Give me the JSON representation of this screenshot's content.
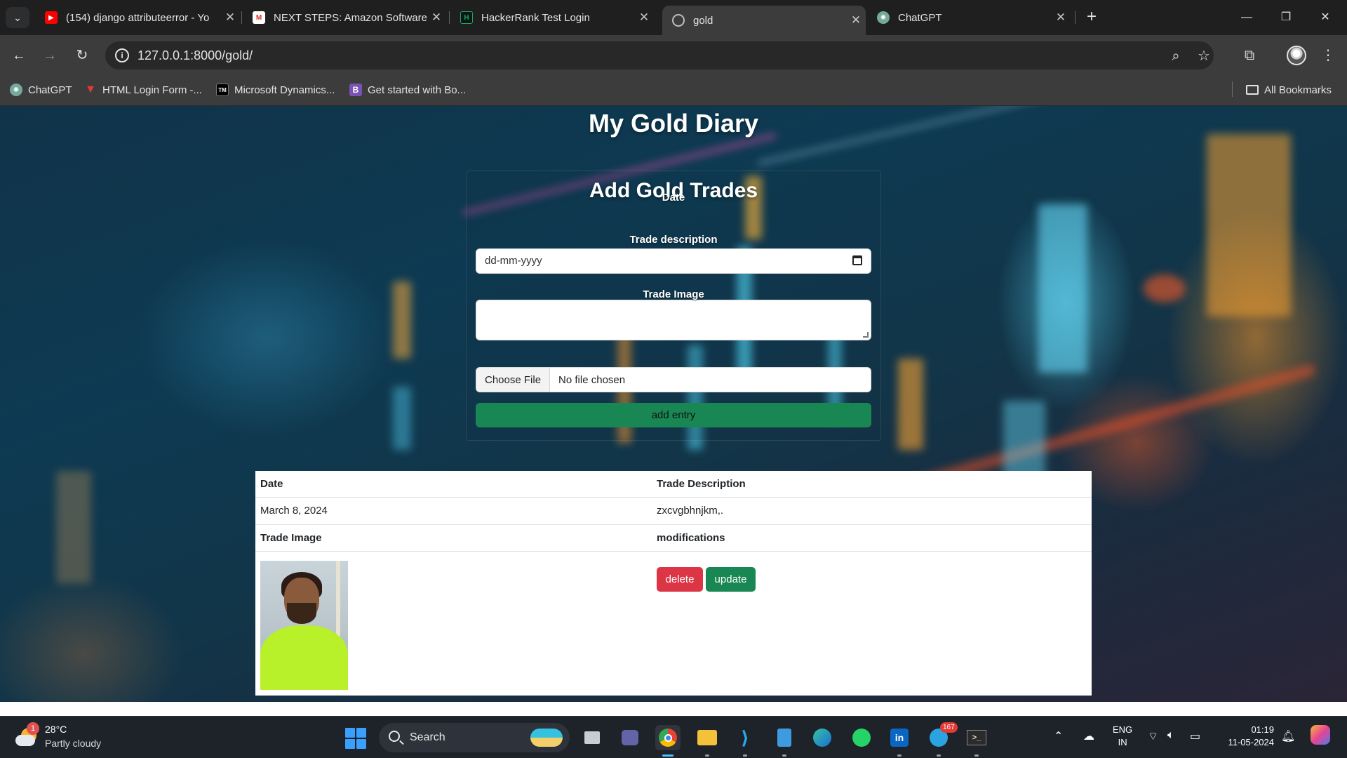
{
  "browser": {
    "tabs": [
      {
        "title": "(154) django attributeerror - Yo",
        "favicon": "youtube-icon"
      },
      {
        "title": "NEXT STEPS: Amazon Software",
        "favicon": "gmail-icon"
      },
      {
        "title": "HackerRank Test Login",
        "favicon": "hackerrank-icon"
      },
      {
        "title": "gold",
        "favicon": "globe-icon",
        "active": true
      },
      {
        "title": "ChatGPT",
        "favicon": "chatgpt-icon"
      }
    ],
    "url": "127.0.0.1:8000/gold/",
    "bookmarks": [
      {
        "label": "ChatGPT",
        "favicon": "chatgpt-icon"
      },
      {
        "label": "HTML Login Form -...",
        "favicon": "v-logo-icon"
      },
      {
        "label": "Microsoft Dynamics...",
        "favicon": "tm-icon"
      },
      {
        "label": "Get started with Bo...",
        "favicon": "bootstrap-icon"
      }
    ],
    "all_bookmarks": "All Bookmarks"
  },
  "page": {
    "title": "My Gold Diary",
    "form": {
      "heading": "Add Gold Trades",
      "date_label": "Date",
      "date_placeholder": "dd-mm-yyyy",
      "description_label": "Trade description",
      "image_label": "Trade Image",
      "choose_file": "Choose File",
      "file_status": "No file chosen",
      "submit": "add entry"
    },
    "table": {
      "date_header": "Date",
      "description_header": "Trade Description",
      "date_value": "March 8, 2024",
      "description_value": "zxcvgbhnjkm,.",
      "image_header": "Trade Image",
      "modifications_header": "modifications",
      "delete": "delete",
      "update": "update"
    }
  },
  "taskbar": {
    "weather_badge": "1",
    "temperature": "28°C",
    "weather": "Partly cloudy",
    "search": "Search",
    "telegram_badge": "167",
    "language": "ENG",
    "region": "IN",
    "time": "01:19",
    "date": "11-05-2024"
  },
  "colors": {
    "success": "#198754",
    "danger": "#dc3545"
  }
}
